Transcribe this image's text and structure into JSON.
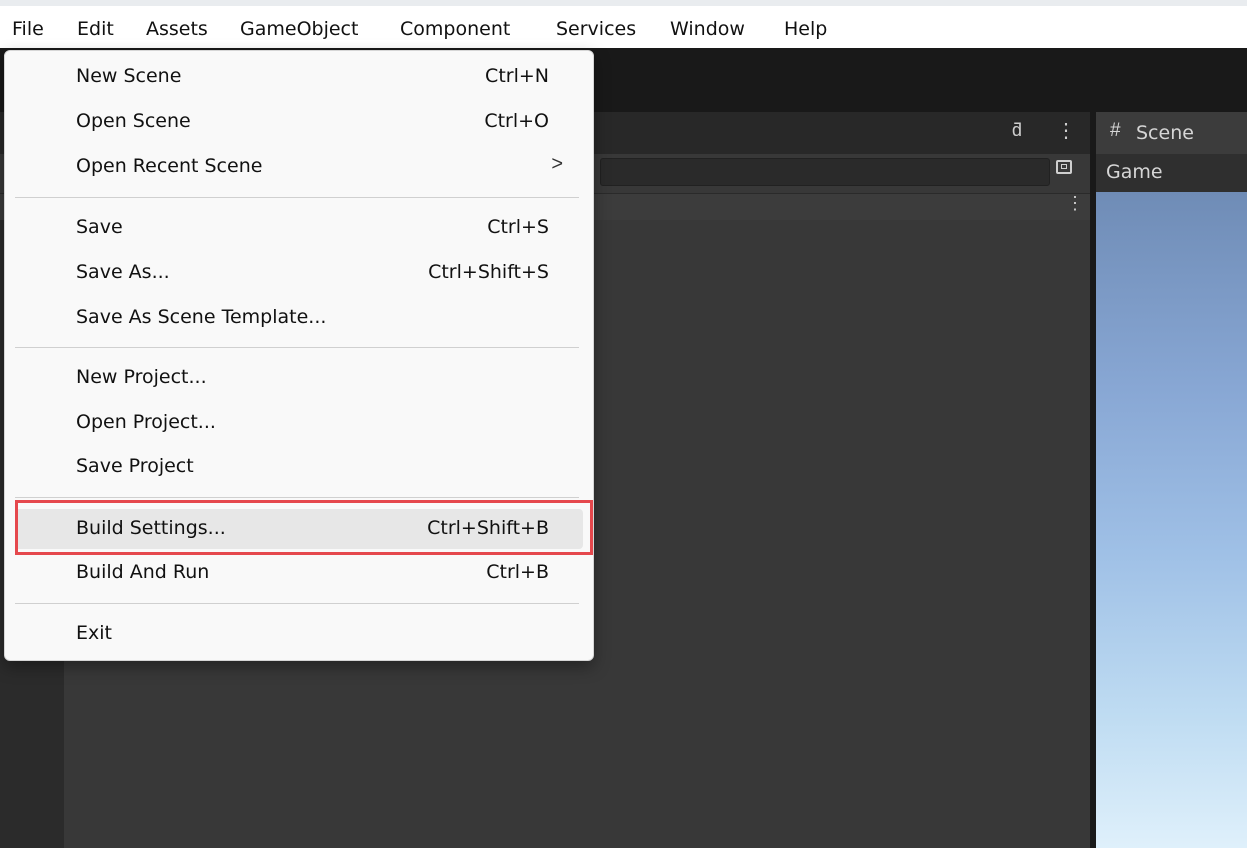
{
  "menubar": {
    "items": [
      "File",
      "Edit",
      "Assets",
      "GameObject",
      "Component",
      "Services",
      "Window",
      "Help"
    ]
  },
  "file_menu": {
    "groups": [
      [
        {
          "label": "New Scene",
          "shortcut": "Ctrl+N"
        },
        {
          "label": "Open Scene",
          "shortcut": "Ctrl+O"
        },
        {
          "label": "Open Recent Scene",
          "shortcut": "",
          "submenu": true
        }
      ],
      [
        {
          "label": "Save",
          "shortcut": "Ctrl+S"
        },
        {
          "label": "Save As...",
          "shortcut": "Ctrl+Shift+S"
        },
        {
          "label": "Save As Scene Template...",
          "shortcut": ""
        }
      ],
      [
        {
          "label": "New Project...",
          "shortcut": ""
        },
        {
          "label": "Open Project...",
          "shortcut": ""
        },
        {
          "label": "Save Project",
          "shortcut": ""
        }
      ],
      [
        {
          "label": "Build Settings...",
          "shortcut": "Ctrl+Shift+B",
          "highlighted": true
        },
        {
          "label": "Build And Run",
          "shortcut": "Ctrl+B"
        }
      ],
      [
        {
          "label": "Exit",
          "shortcut": ""
        }
      ]
    ],
    "submenu_arrow": ">"
  },
  "scene_panel": {
    "scene_tab_icon": "#",
    "scene_tab_label": "Scene",
    "game_label": "Game"
  },
  "icons": {
    "lock": "lock-icon",
    "kebab": "kebab-menu-icon",
    "popout": "popout-icon"
  },
  "colors": {
    "highlight_box": "#e5484d",
    "editor_dark": "#383838",
    "sky_top": "#6f8cb6",
    "sky_bottom": "#dff0fb"
  }
}
